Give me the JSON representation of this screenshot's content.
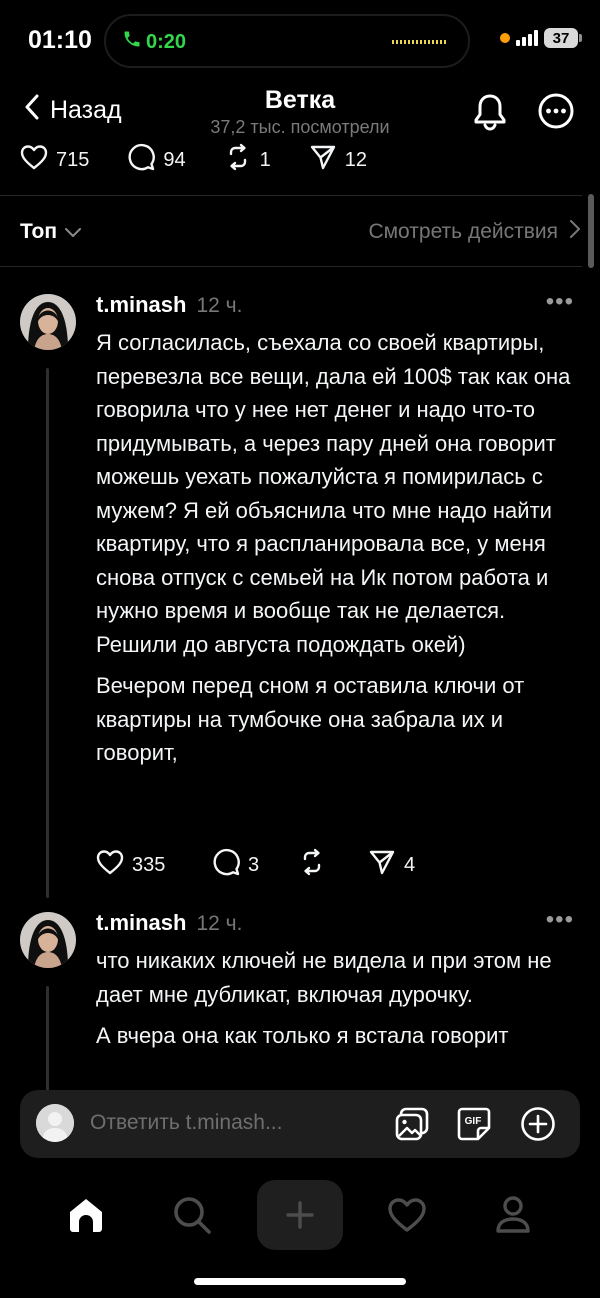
{
  "status_bar": {
    "time": "01:10",
    "call_duration": "0:20",
    "battery": "37",
    "call_color": "#32d74b"
  },
  "header": {
    "back_label": "Назад",
    "title": "Ветка",
    "subtitle": "37,2 тыс. посмотрели",
    "icons": [
      "bell-icon",
      "more-options-icon"
    ]
  },
  "post_stats": {
    "likes": "715",
    "replies": "94",
    "reposts": "1",
    "shares": "12"
  },
  "sort_bar": {
    "sort_label": "Топ",
    "view_activity_label": "Смотреть действия"
  },
  "replies": [
    {
      "username": "t.minash",
      "time_ago": "12 ч.",
      "paragraphs": [
        "Я согласилась, съехала со своей квартиры, перевезла все вещи, дала ей 100$ так как она говорила что у нее нет денег и надо что-то придумывать, а через пару дней она говорит можешь уехать пожалуйста я помирилась с мужем? Я ей объяснила что мне надо найти квартиру, что я распланировала все, у меня снова отпуск с семьей на Ик потом работа и нужно время и вообще так не делается. Решили до августа подождать окей)",
        "Вечером перед сном я оставила ключи от квартиры на тумбочке она забрала их и говорит,"
      ],
      "likes": "335",
      "replies": "3",
      "reposts": "",
      "shares": "4"
    },
    {
      "username": "t.minash",
      "time_ago": "12 ч.",
      "paragraphs": [
        "что никаких ключей не видела и при этом не дает мне дубликат, включая дурочку.",
        "А вчера она как только я встала говорит"
      ]
    }
  ],
  "compose": {
    "placeholder": "Ответить t.minash...",
    "icons": [
      "gallery-icon",
      "gif-icon",
      "add-icon"
    ]
  },
  "tab_bar": {
    "tabs": [
      "home-icon",
      "search-icon",
      "create-icon",
      "activity-heart-icon",
      "profile-icon"
    ]
  }
}
